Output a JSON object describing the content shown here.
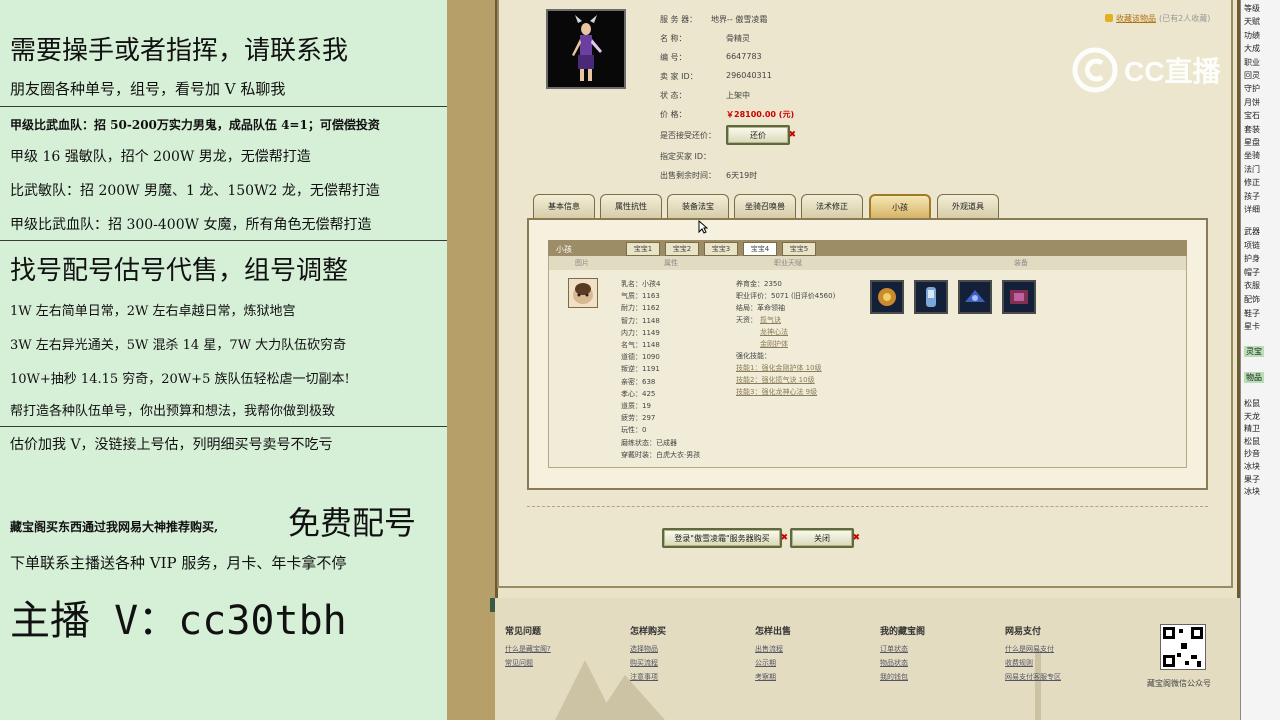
{
  "left_panel": {
    "line1": "需要操手或者指挥，请联系我",
    "line2": "朋友圈各种单号，组号，看号加 V 私聊我",
    "line3": "甲级比武血队：招 50-200万实力男鬼，成品队伍 4=1；可偿偿投资",
    "line4": "甲级 16 强敏队，招个 200W 男龙，无偿帮打造",
    "line5": "比武敏队：招 200W 男魔、1 龙、150W2 龙，无偿帮打造",
    "line6": "甲级比武血队：招 300-400W 女魔，所有角色无偿帮打造",
    "line7": "找号配号估号代售，组号调整",
    "line8": "1W 左右简单日常，2W 左右卓越日常，炼狱地宫",
    "line9": "3W 左右异光通关，5W 混杀 14 星，7W 大力队伍砍穷奇",
    "line10": "10W+抽秒 14.15 穷奇，20W+5 族队伍轻松虐一切副本!",
    "line11": "帮打造各种队伍单号，你出预算和想法，我帮你做到极致",
    "line12": "估价加我 V，没链接上号估，列明细买号卖号不吃亏",
    "line13a": "藏宝阁买东西通过我网易大神推荐购买,",
    "line13b": "免费配号",
    "line14": "下单联系主播送各种 VIP 服务，月卡、年卡拿不停",
    "line15": "主播 V：cc30tbh"
  },
  "account": {
    "server_label": "服 务 器：",
    "server_value": "地界-- 傲雪凌霜",
    "name_label": "名      称：",
    "name_value": "骨精灵",
    "id_label": "编      号：",
    "id_value": "6647783",
    "seller_label": "卖 家 ID：",
    "seller_value": "296040311",
    "status_label": "状      态：",
    "status_value": "上架中",
    "price_label": "价      格：",
    "price_value": "￥28100.00 (元)",
    "counter_label": "是否接受还价：",
    "counter_button": "还价",
    "buyer_label": "指定买家 ID：",
    "remain_label": "出售剩余时间：",
    "remain_value": "6天19时",
    "favorite": "收藏该物品",
    "favorite_count": "(已有2人收藏)"
  },
  "tabs": [
    "基本信息",
    "属性抗性",
    "装备法宝",
    "坐骑召唤兽",
    "法术修正",
    "小孩",
    "外观道具"
  ],
  "subpanel": {
    "title": "小孩",
    "subtabs": [
      "宝宝1",
      "宝宝2",
      "宝宝3",
      "宝宝4",
      "宝宝5"
    ],
    "columns": [
      "图片",
      "属性",
      "职业天赋",
      "装备"
    ],
    "stats": [
      "乳名：小孩4",
      "气质：1163",
      "耐力：1162",
      "智力：1148",
      "内力：1149",
      "名气：1148",
      "道德：1090",
      "叛逆：1191",
      "亲密：638",
      "孝心：425",
      "道质：19",
      "疲劳：297",
      "玩性：0",
      "磨练状态：已成器",
      "穿戴时装：白虎大衣·男孩"
    ],
    "career": [
      "养育金：2350",
      "职业评价：5071 (旧评价4560)",
      "结局：革命领袖",
      "天资：",
      "强化技能："
    ],
    "talents": [
      "揽气诀",
      "龙神心法",
      "金刚护体"
    ],
    "skills": [
      "技能1：强化金刚护体 10级",
      "技能2：强化揽气诀 10级",
      "技能3：强化龙神心法 9级"
    ]
  },
  "bottom_buttons": {
    "login": "登录\"傲雪凌霜\"服务器购买",
    "close": "关闭"
  },
  "footer": {
    "cols": [
      {
        "title": "常见问题",
        "links": [
          "什么是藏宝阁?",
          "常见问题"
        ]
      },
      {
        "title": "怎样购买",
        "links": [
          "选择物品",
          "购买流程",
          "注意事项"
        ]
      },
      {
        "title": "怎样出售",
        "links": [
          "出售流程",
          "公示期",
          "考察期"
        ]
      },
      {
        "title": "我的藏宝阁",
        "links": [
          "订单状态",
          "物品状态",
          "我的钱包"
        ]
      },
      {
        "title": "网易支付",
        "links": [
          "什么是网易支付",
          "收费规则",
          "网易支付客服专区"
        ]
      }
    ],
    "qr_caption": "藏宝阁微信公众号"
  },
  "watermark": "CC直播",
  "right_strip": [
    "等级",
    "天赋",
    "功绩",
    "大成",
    "职业",
    "回灵",
    "守护",
    "月饼",
    "宝石",
    "套装",
    "星盘",
    "坐骑",
    "法门",
    "修正",
    "孩子",
    "详细"
  ],
  "right_strip2": [
    "武器",
    "项链",
    "护身",
    "帽子",
    "衣服",
    "配饰",
    "鞋子",
    "星卡"
  ],
  "right_strip3": [
    "灵宝",
    "物品"
  ],
  "right_strip4": [
    "松鼠",
    "天龙",
    "精卫",
    "松鼠",
    "抄音",
    "冰块",
    "果子",
    "冰块"
  ]
}
